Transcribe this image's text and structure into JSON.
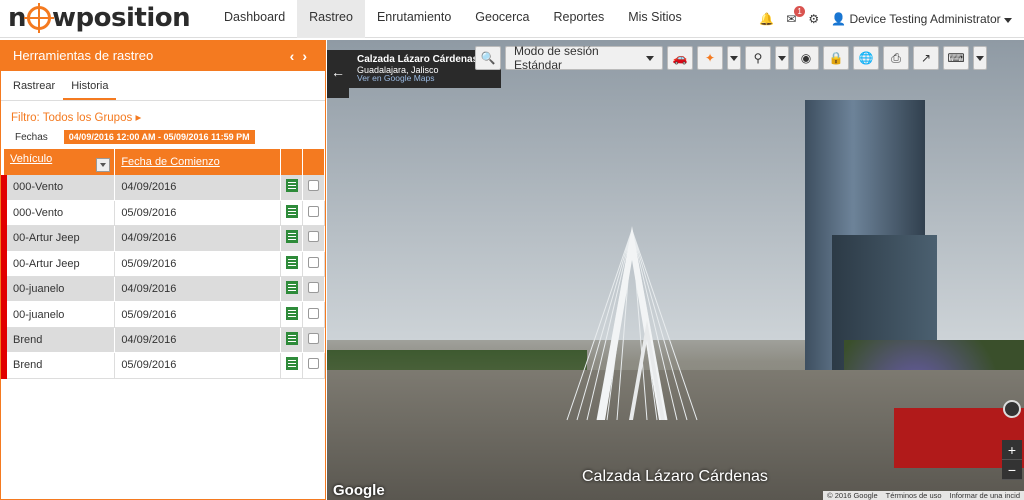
{
  "brand": {
    "logo_text_left": "n",
    "logo_text_right": "wposition"
  },
  "nav": {
    "items": [
      {
        "label": "Dashboard",
        "active": false
      },
      {
        "label": "Rastreo",
        "active": true
      },
      {
        "label": "Enrutamiento",
        "active": false
      },
      {
        "label": "Geocerca",
        "active": false
      },
      {
        "label": "Reportes",
        "active": false
      },
      {
        "label": "Mis Sitios",
        "active": false
      }
    ],
    "notification_count": "1",
    "user_name": "Device Testing Administrator"
  },
  "panel": {
    "title": "Herramientas de rastreo",
    "tabs": [
      {
        "label": "Rastrear",
        "active": false
      },
      {
        "label": "Historia",
        "active": true
      }
    ],
    "filter_label": "Filtro: Todos los Grupos",
    "fechas_label": "Fechas",
    "date_range": "04/09/2016 12:00 AM - 05/09/2016 11:59 PM",
    "columns": [
      "Vehículo",
      "Fecha de Comienzo"
    ],
    "rows": [
      {
        "vehicle": "000-Vento",
        "date": "04/09/2016"
      },
      {
        "vehicle": "000-Vento",
        "date": "05/09/2016"
      },
      {
        "vehicle": "00-Artur Jeep",
        "date": "04/09/2016"
      },
      {
        "vehicle": "00-Artur Jeep",
        "date": "05/09/2016"
      },
      {
        "vehicle": "00-juanelo",
        "date": "04/09/2016"
      },
      {
        "vehicle": "00-juanelo",
        "date": "05/09/2016"
      },
      {
        "vehicle": "Brend",
        "date": "04/09/2016"
      },
      {
        "vehicle": "Brend",
        "date": "05/09/2016"
      }
    ]
  },
  "view": {
    "place_title": "Calzada Lázaro Cárdenas",
    "place_subtitle": "Guadalajara, Jalisco",
    "place_link": "Ver en Google Maps",
    "session_mode": "Modo de sesión Estándar",
    "street_label": "Calzada Lázaro Cárdenas",
    "google_label": "Google",
    "footer": [
      "© 2016 Google",
      "Términos de uso",
      "Informar de una incid"
    ]
  }
}
